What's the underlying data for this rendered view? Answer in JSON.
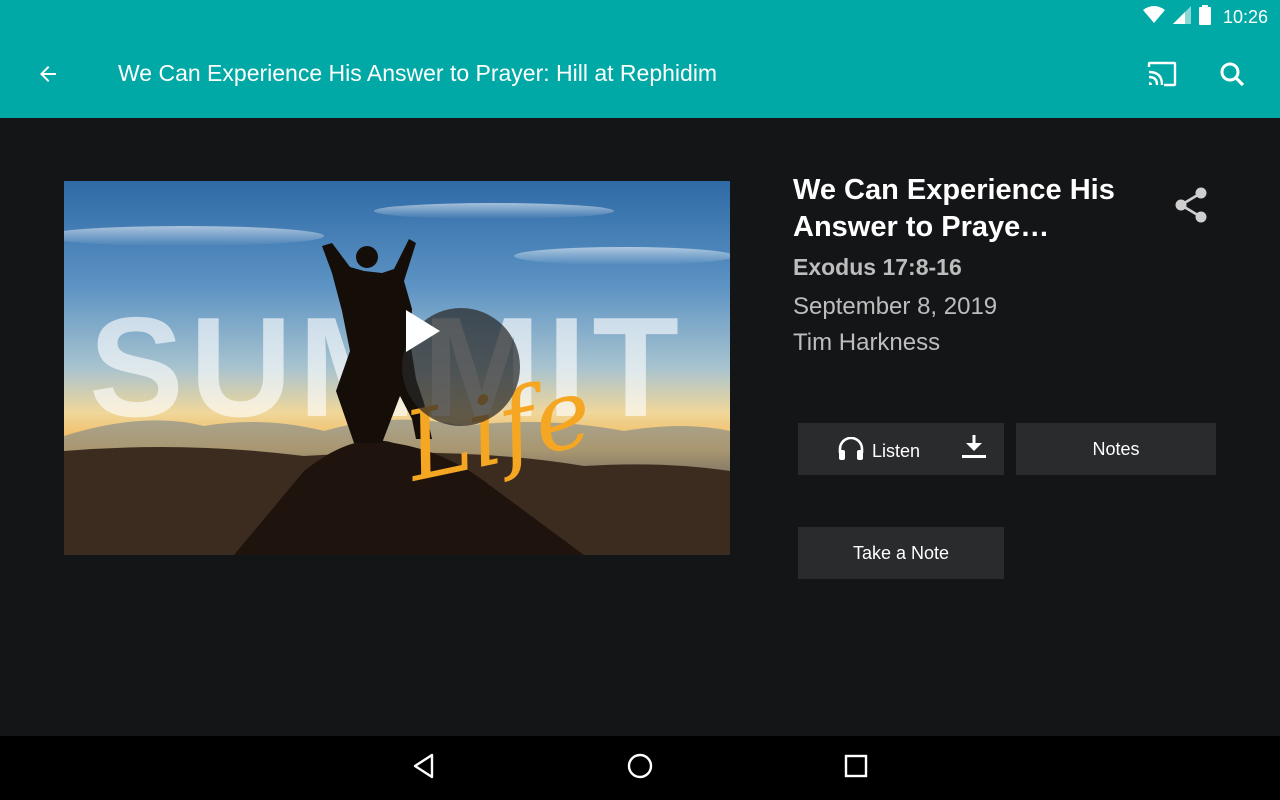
{
  "status_bar": {
    "time": "10:26",
    "icons": [
      "wifi-icon",
      "signal-icon",
      "battery-icon"
    ]
  },
  "app_bar": {
    "title": "We Can Experience His Answer to Prayer: Hill at Rephidim",
    "background_color": "#00a9a5",
    "icons": [
      "back-arrow-icon",
      "cast-icon",
      "search-icon"
    ]
  },
  "media": {
    "thumbnail_text": "SUMMIT",
    "thumbnail_script": "Life",
    "play_icon": "play-icon"
  },
  "sermon": {
    "title": "We Can Experience His Answer to Praye…",
    "scripture": "Exodus 17:8-16",
    "date": "September 8, 2019",
    "speaker": "Tim Harkness",
    "share_icon": "share-icon"
  },
  "actions": {
    "listen_label": "Listen",
    "notes_label": "Notes",
    "take_note_label": "Take a Note",
    "icons": [
      "headphones-icon",
      "download-icon"
    ]
  },
  "nav_bar": {
    "icons": [
      "back-triangle-icon",
      "home-circle-icon",
      "recents-square-icon"
    ]
  }
}
